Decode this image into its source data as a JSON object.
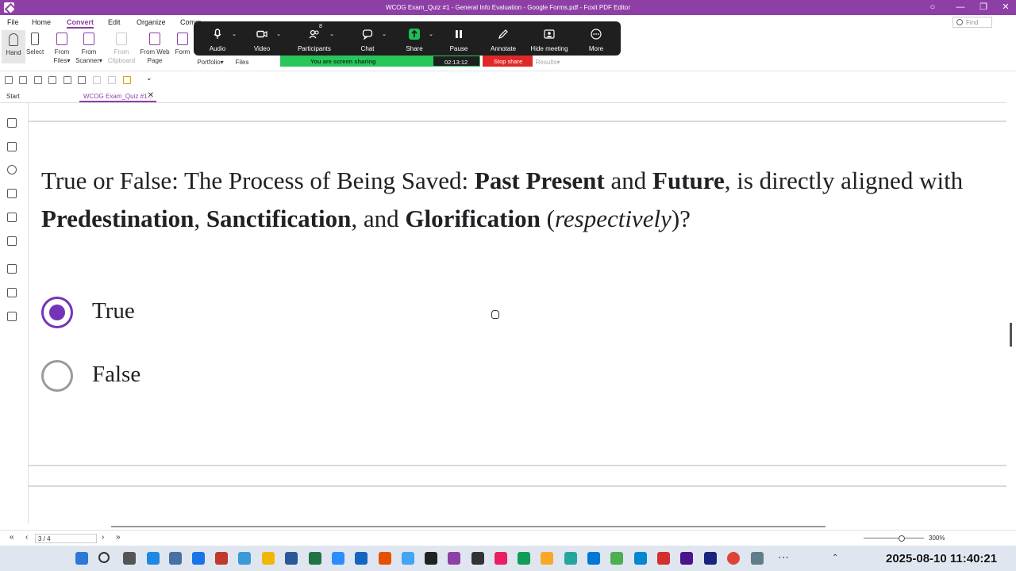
{
  "window": {
    "title": "WCOG Exam_Quiz #1 - General Info Evaluation - Google Forms.pdf - Foxit PDF Editor",
    "controls": [
      "○",
      "—",
      "❐",
      "✕"
    ]
  },
  "menu": {
    "tabs": [
      {
        "label": "File"
      },
      {
        "label": "Home"
      },
      {
        "label": "Convert"
      },
      {
        "label": "Edit"
      },
      {
        "label": "Organize"
      },
      {
        "label": "Comm"
      }
    ],
    "find_placeholder": "Find"
  },
  "ribbon": {
    "hand": "Hand",
    "select": "Select",
    "from_files": "From Files▾",
    "from_scanner": "From Scanner▾",
    "from_clipboard": "From Clipboard",
    "from_web_page": "From Web Page",
    "form": "Form",
    "portfolio": "Portfolio▾",
    "files": "Files",
    "results": "Results▾"
  },
  "meeting": {
    "audio": "Audio",
    "video": "Video",
    "participants": "Participants",
    "participants_count": "8",
    "chat": "Chat",
    "share": "Share",
    "pause": "Pause",
    "annotate": "Annotate",
    "hide_meeting": "Hide meeting",
    "more": "More",
    "sharing_text": "You are screen sharing",
    "timer": "02:13:12",
    "stop_share": "Stop share",
    "share_color": "#1fbd57",
    "stop_color": "#e02828"
  },
  "tabs": {
    "start": "Start",
    "document": "WCOG Exam_Quiz #1..."
  },
  "question": {
    "p1": "True or False: The Process of Being Saved: ",
    "b1": "Past Present",
    "p2": " and ",
    "b2": "Future",
    "p3": ", is directly aligned with ",
    "b3": "Predestination",
    "p4": ", ",
    "b4": "Sanctification",
    "p5": ", and ",
    "b5": "Glorification",
    "p6": " (",
    "i1": "respectively",
    "p7": ")?"
  },
  "options": [
    {
      "label": "True",
      "selected": true
    },
    {
      "label": "False",
      "selected": false
    }
  ],
  "accent_color": "#7534b8",
  "status": {
    "page": "3 / 4",
    "zoom": "300%"
  },
  "taskbar": {
    "clock": "2025-08-10 11:40:21"
  }
}
